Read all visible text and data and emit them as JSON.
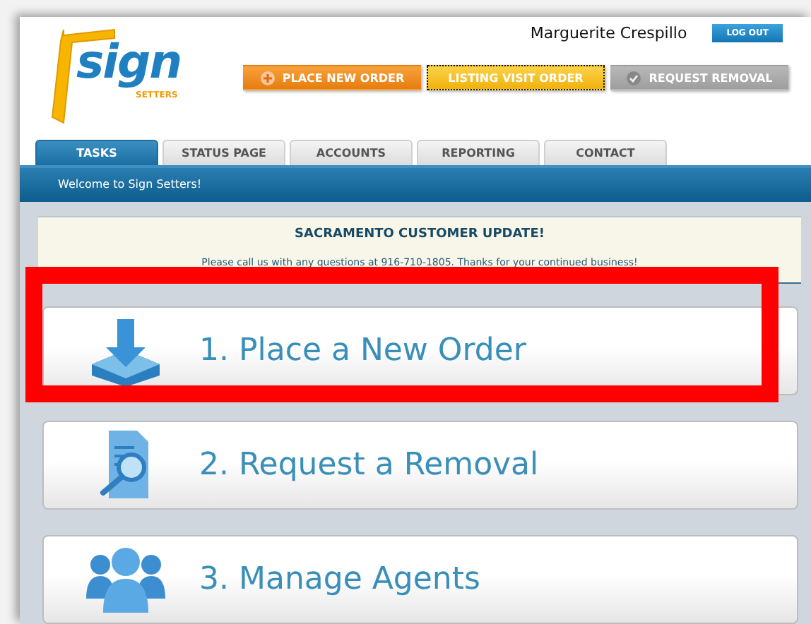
{
  "logo": {
    "word": "sign",
    "sub": "SETTERS"
  },
  "user": {
    "name": "Marguerite Crespillo",
    "logout": "LOG OUT"
  },
  "actions": [
    {
      "label": "PLACE NEW ORDER",
      "kind": "orange",
      "focused": false
    },
    {
      "label": "LISTING VISIT ORDER",
      "kind": "yellow",
      "focused": true
    },
    {
      "label": "REQUEST REMOVAL",
      "kind": "gray",
      "focused": false
    }
  ],
  "tabs": [
    {
      "label": "TASKS",
      "selected": true
    },
    {
      "label": "STATUS PAGE",
      "selected": false
    },
    {
      "label": "ACCOUNTS",
      "selected": false
    },
    {
      "label": "REPORTING",
      "selected": false
    },
    {
      "label": "CONTACT",
      "selected": false
    }
  ],
  "welcome": "Welcome to Sign Setters!",
  "notice": {
    "title": "SACRAMENTO CUSTOMER UPDATE!",
    "text": "Please call us with any questions at 916-710-1805. Thanks for your continued business!"
  },
  "tasks": [
    {
      "label": "1. Place a New Order",
      "kind": "download",
      "highlighted": true
    },
    {
      "label": "2. Request a Removal",
      "kind": "document",
      "highlighted": false
    },
    {
      "label": "3. Manage Agents",
      "kind": "people",
      "highlighted": false
    }
  ]
}
